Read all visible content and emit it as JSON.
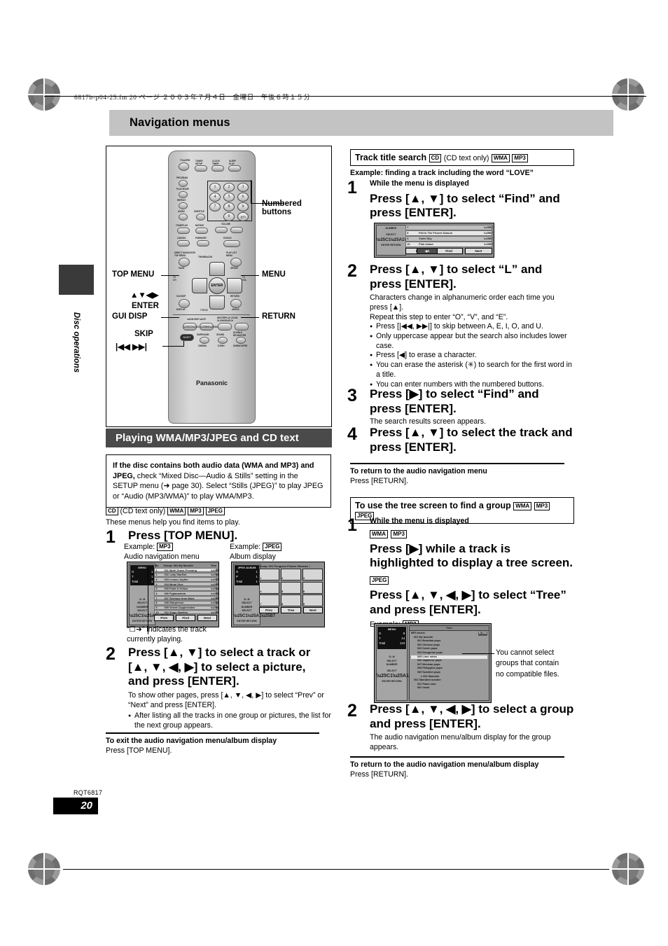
{
  "header": {
    "file_info": "6817b-p04-25.fm  20 ページ  ２００３年７月４日　金曜日　午後６時１５分",
    "title": "Navigation menus"
  },
  "sidebar": {
    "tab_label": "Disc operations"
  },
  "footer": {
    "doc_code": "RQT6817",
    "page_number": "20"
  },
  "remote": {
    "callouts": {
      "numbered_buttons": "Numbered\nbuttons",
      "top_menu": "TOP MENU",
      "menu": "MENU",
      "arrows": "▲▼◀▶",
      "enter": "ENTER",
      "gui_disp": "GUI DISP",
      "return": "RETURN",
      "skip": "SKIP",
      "skip_glyphs": "|◀◀   ▶▶|"
    },
    "brand": "Panasonic",
    "keys": [
      "TV",
      "TUNER/BAND SETUP",
      "CLOCK TIMER",
      "SLEEP PLAY",
      "PROGRAM",
      "PLAY MODE",
      "REPEAT",
      "AUDIO",
      "SUBTITLE",
      "TONE/FLUX",
      "MUTING",
      "VOLUME",
      "CANCEL",
      "P.MEMORY",
      "DVD/CD",
      "DIRECT NAVIGATOR TOP MENU",
      "PLAY LIST MENU",
      "PAGE",
      "GROUP",
      "GUI DISP DISPLAY",
      "RETURN ANGLE",
      "SKIP",
      "SLOW/SEARCH",
      "SHIFT",
      "SURROUND",
      "SOUND",
      "DOUBLE RE-MASTER",
      "CINEMA",
      "D.ENH",
      "SUBWOOFER"
    ],
    "numbers": [
      "1",
      "2",
      "3",
      "4",
      "5",
      "6",
      "7",
      "8",
      "9",
      "0",
      "≧10"
    ]
  },
  "left": {
    "section_title": "Playing WMA/MP3/JPEG and CD text",
    "info_box": {
      "lead_bold": "If the disc contains both audio data (WMA and MP3) and JPEG,",
      "rest": " check “Mixed Disc—Audio & Stills” setting in the SETUP menu (➜ page 30). Select “Stills (JPEG)” to play JPEG or “Audio (MP3/WMA)” to play WMA/MP3."
    },
    "format_line_badges": [
      "CD",
      "WMA",
      "MP3",
      "JPEG"
    ],
    "format_line_note": "(CD text only)",
    "intro": "These menus help you find items to play.",
    "step1": {
      "num": "1",
      "title": "Press [TOP MENU].",
      "example_left_label": "Example:",
      "example_left_badge": "MP3",
      "example_left_caption": "Audio navigation menu",
      "example_right_label": "Example:",
      "example_right_badge": "JPEG",
      "example_right_caption": "Album display",
      "caption_note": "“☐➜” indicates the track currently playing."
    },
    "audio_nav_screen": {
      "panel_title": "MENU",
      "info": [
        {
          "k": "G",
          "v": "1"
        },
        {
          "k": "T",
          "v": "1"
        },
        {
          "k": "Total",
          "v": "1"
        }
      ],
      "guide": [
        "①–⑨",
        "SELECT",
        "NUMBER",
        "SELECT",
        "ENTER   RETURN"
      ],
      "col_no": "No",
      "col_group": "Group: 001 My favorite",
      "col_tree": "Tree",
      "rows": [
        {
          "no": "1",
          "name": "001 Moth Grass Pressing"
        },
        {
          "no": "2",
          "name": "002 Lady Starfish"
        },
        {
          "no": "3",
          "name": "003 Lemon Jupiter"
        },
        {
          "no": "4",
          "name": "004 Metal Glue"
        },
        {
          "no": "5",
          "name": "005 Paint It Yellow"
        },
        {
          "no": "6",
          "name": "006 Pyjamarama"
        },
        {
          "no": "7",
          "name": "007 Shrimps from Mars"
        },
        {
          "no": "8",
          "name": "008 Starperson"
        },
        {
          "no": "9",
          "name": "009 Velvet Copperrmine"
        },
        {
          "no": "10",
          "name": "010 Ziggy Starfish"
        }
      ],
      "buttons": [
        "Prev",
        "Find",
        "Next"
      ]
    },
    "album_screen": {
      "panel_title": "JPEG ALBUM",
      "info": [
        {
          "k": "G",
          "v": "1"
        },
        {
          "k": "P",
          "v": "1"
        },
        {
          "k": "Total",
          "v": "1"
        }
      ],
      "header": "Group: 001 Penguins      Picture filename⋮",
      "thumbs": [
        "1",
        "2",
        "3",
        "4",
        "5",
        "6",
        "7",
        "8",
        "9"
      ],
      "buttons": [
        "Prev",
        "Tree",
        "Next"
      ]
    },
    "step2": {
      "num": "2",
      "title": "Press [▲, ▼] to select a track or [▲, ▼, ◀, ▶] to select a picture, and press [ENTER].",
      "body": "To show other pages, press [▲, ▼, ◀, ▶] to select “Prev” or “Next” and press [ENTER].",
      "bullets": [
        "After listing all the tracks in one group or pictures, the list for the next group appears."
      ]
    },
    "exit_note": {
      "heading": "To exit the audio navigation menu/album display",
      "body": "Press [TOP MENU]."
    }
  },
  "right": {
    "track_search": {
      "heading": "Track title search",
      "heading_badges": [
        "CD",
        "WMA",
        "MP3"
      ],
      "heading_note": "(CD text only)",
      "example": "Example:  finding a track including the word “LOVE”",
      "step1": {
        "num": "1",
        "pre": "While the menu is displayed",
        "title": "Press [▲, ▼] to select “Find” and press [ENTER]."
      },
      "search_screen": {
        "guide": [
          "NUMBER",
          "SELECT",
          "ENTER   RETURN"
        ],
        "rows": [
          {
            "no": "7",
            "name": ""
          },
          {
            "no": "8",
            "name": "Fall In The Frozen Season"
          },
          {
            "no": "9",
            "name": "Violet Sky"
          },
          {
            "no": "10",
            "name": "Pink Island"
          }
        ],
        "buttons": [
          "Prev",
          "Find",
          "Next"
        ],
        "input_value": "◀A"
      },
      "step2": {
        "num": "2",
        "title": "Press [▲, ▼] to select “L” and press [ENTER].",
        "body1": "Characters change in alphanumeric order each time you press [▲].",
        "body2": "Repeat this step to enter “O”, “V”, and “E”.",
        "bullets": [
          "Press [|◀◀, ▶▶|] to skip between A, E, I, O, and U.",
          "Only uppercase appear but the search also includes lower case.",
          "Press [◀] to erase a character.",
          "You can erase the asterisk (✳) to search for the first word in a title.",
          "You can enter numbers with the numbered buttons."
        ]
      },
      "step3": {
        "num": "3",
        "title": "Press [▶] to select “Find” and press [ENTER].",
        "body": "The search results screen appears."
      },
      "step4": {
        "num": "4",
        "title": "Press [▲, ▼] to select the track and press [ENTER]."
      },
      "return_note": {
        "heading": "To return to the audio navigation menu",
        "body": "Press [RETURN]."
      }
    },
    "tree_section": {
      "heading": "To use the tree screen to find a group",
      "heading_badges": [
        "WMA",
        "MP3",
        "JPEG"
      ],
      "step1": {
        "num": "1",
        "pre": "While the menu is displayed",
        "badges_a": [
          "WMA",
          "MP3"
        ],
        "title_a": "Press [▶] while a track is highlighted to display a tree screen.",
        "badges_b": [
          "JPEG"
        ],
        "title_b": "Press [▲, ▼, ◀, ▶] to select “Tree” and press [ENTER].",
        "example_label": "Example:",
        "example_badge": "MP3"
      },
      "tree_screen": {
        "panel_title": "MENU",
        "info": [
          {
            "k": "G",
            "v": "8"
          },
          {
            "k": "T",
            "v": "14"
          },
          {
            "k": "Total",
            "v": "123"
          }
        ],
        "guide": [
          "①–⑨",
          "SELECT",
          "NUMBER",
          "SELECT",
          "ENTER   RETURN"
        ],
        "title": "Tree",
        "root": "MP3 music",
        "root_badge": "G  7/16",
        "items": [
          {
            "label": "001 My favorite",
            "depth": 1,
            "selected": false
          },
          {
            "label": "001 Brazilian pops",
            "depth": 2,
            "selected": false
          },
          {
            "label": "002 Chinese pops",
            "depth": 2,
            "selected": false
          },
          {
            "label": "003 Czech pops",
            "depth": 2,
            "selected": false
          },
          {
            "label": "004 Hungarian pops",
            "depth": 2,
            "selected": false
          },
          {
            "label": "005 Liner notes",
            "depth": 2,
            "selected": true
          },
          {
            "label": "006 Japanese pops",
            "depth": 2,
            "selected": false
          },
          {
            "label": "007 Mexican pops",
            "depth": 2,
            "selected": false
          },
          {
            "label": "008 Philippine pops",
            "depth": 2,
            "selected": false
          },
          {
            "label": "009 Swedish pops",
            "depth": 2,
            "selected": false
          },
          {
            "label": "L 001 Momoko",
            "depth": 3,
            "selected": false
          },
          {
            "label": "002 Standard number",
            "depth": 1,
            "selected": false
          },
          {
            "label": "001 Piano solo",
            "depth": 2,
            "selected": false
          },
          {
            "label": "002 Vocal",
            "depth": 2,
            "selected": false
          }
        ],
        "callout": "You cannot select groups that contain no compatible files."
      },
      "step2": {
        "num": "2",
        "title": "Press [▲, ▼, ◀, ▶] to select a group and press [ENTER].",
        "body": "The audio navigation menu/album display for the group appears."
      },
      "return_note": {
        "heading": "To return to the audio navigation menu/album display",
        "body": "Press [RETURN]."
      }
    }
  }
}
